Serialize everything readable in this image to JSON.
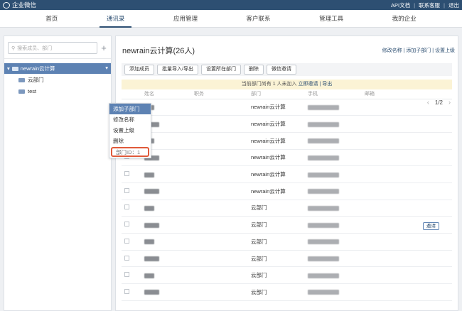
{
  "topbar": {
    "brand": "企业微信",
    "links": [
      "API文档",
      "联系客服",
      "退出"
    ]
  },
  "nav": [
    "首页",
    "通讯录",
    "应用管理",
    "客户联系",
    "管理工具",
    "我的企业"
  ],
  "left": {
    "search_placeholder": "搜索成员、部门",
    "root": "newrain云计算",
    "children": [
      "云部门",
      "test"
    ]
  },
  "ctxmenu": [
    "添加子部门",
    "修改名称",
    "设置上级",
    "删除",
    "部门ID：1"
  ],
  "right": {
    "title": "newrain云计算(26人)",
    "links": "修改名称 | 添加子部门 | 设置上级",
    "toolbar": [
      "添加成员",
      "批量导入/导出",
      "设置所在部门",
      "删除",
      "微信邀请"
    ],
    "pager": "1/2",
    "notice_text": "当前部门尚有 1 人未加入",
    "notice_link": "立即邀请 | 导出",
    "columns": [
      "",
      "姓名",
      "职务",
      "部门",
      "手机",
      "邮箱"
    ],
    "rows": [
      {
        "dept": "newrain云计算",
        "phone": "",
        "invite": ""
      },
      {
        "dept": "newrain云计算",
        "phone": "",
        "invite": ""
      },
      {
        "dept": "newrain云计算",
        "phone": "",
        "invite": ""
      },
      {
        "dept": "newrain云计算",
        "phone": "",
        "invite": ""
      },
      {
        "dept": "newrain云计算",
        "phone": "",
        "invite": ""
      },
      {
        "dept": "newrain云计算",
        "phone": "",
        "invite": ""
      },
      {
        "dept": "云部门",
        "phone": "",
        "invite": ""
      },
      {
        "dept": "云部门",
        "phone": "",
        "invite": "邀请"
      },
      {
        "dept": "云部门",
        "phone": "",
        "invite": ""
      },
      {
        "dept": "云部门",
        "phone": "",
        "invite": ""
      },
      {
        "dept": "云部门",
        "phone": "",
        "invite": ""
      },
      {
        "dept": "云部门",
        "phone": "",
        "invite": ""
      }
    ]
  }
}
